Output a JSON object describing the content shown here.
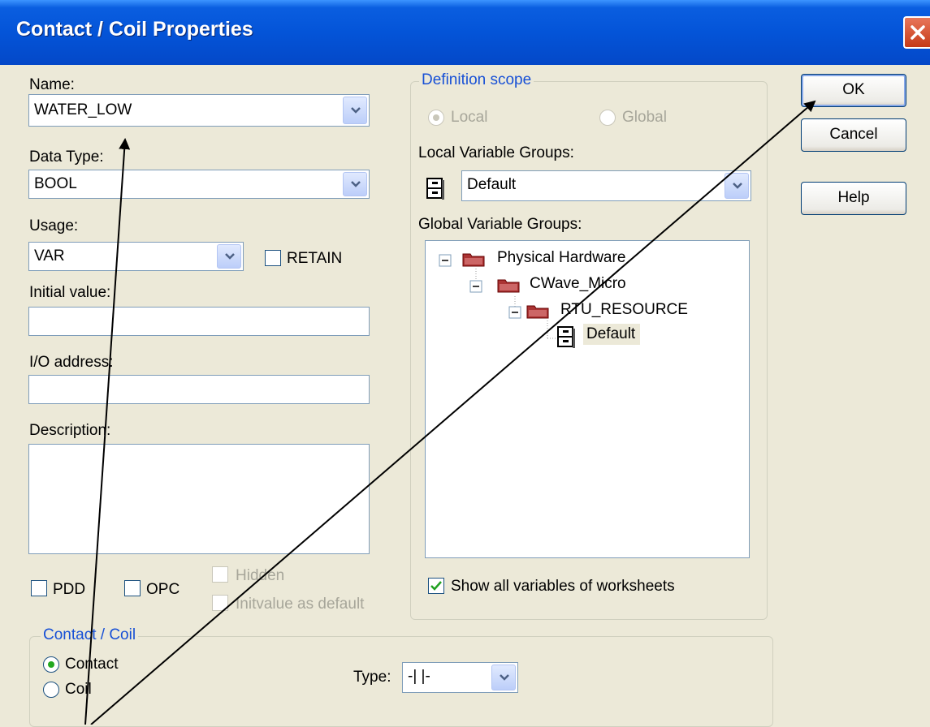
{
  "window": {
    "title": "Contact / Coil Properties"
  },
  "name": {
    "label": "Name:",
    "value": "WATER_LOW"
  },
  "data_type": {
    "label": "Data Type:",
    "value": "BOOL"
  },
  "usage": {
    "label": "Usage:",
    "value": "VAR",
    "retain_label": "RETAIN"
  },
  "initial_value": {
    "label": "Initial value:",
    "value": ""
  },
  "io_address": {
    "label": "I/O address:",
    "value": ""
  },
  "description": {
    "label": "Description:",
    "value": ""
  },
  "options": {
    "pdd": "PDD",
    "opc": "OPC",
    "hidden": "Hidden",
    "initvalue_default": "Initvalue as default"
  },
  "scope": {
    "title": "Definition scope",
    "local": "Local",
    "global": "Global",
    "local_groups_label": "Local Variable Groups:",
    "local_groups_value": "Default",
    "global_groups_label": "Global Variable Groups:",
    "tree": [
      "Physical Hardware",
      "CWave_Micro",
      "RTU_RESOURCE",
      "Default"
    ],
    "show_all_label": "Show all variables of worksheets",
    "show_all_checked": true
  },
  "contact_coil": {
    "title": "Contact / Coil",
    "contact": "Contact",
    "coil": "Coil",
    "type_label": "Type:",
    "type_value": "-| |-",
    "selected": "Contact"
  },
  "buttons": {
    "ok": "OK",
    "cancel": "Cancel",
    "help": "Help"
  },
  "colors": {
    "titlebar": "#0454d8",
    "accent_blue": "#1750d6",
    "dialog_bg": "#ece9d8"
  }
}
